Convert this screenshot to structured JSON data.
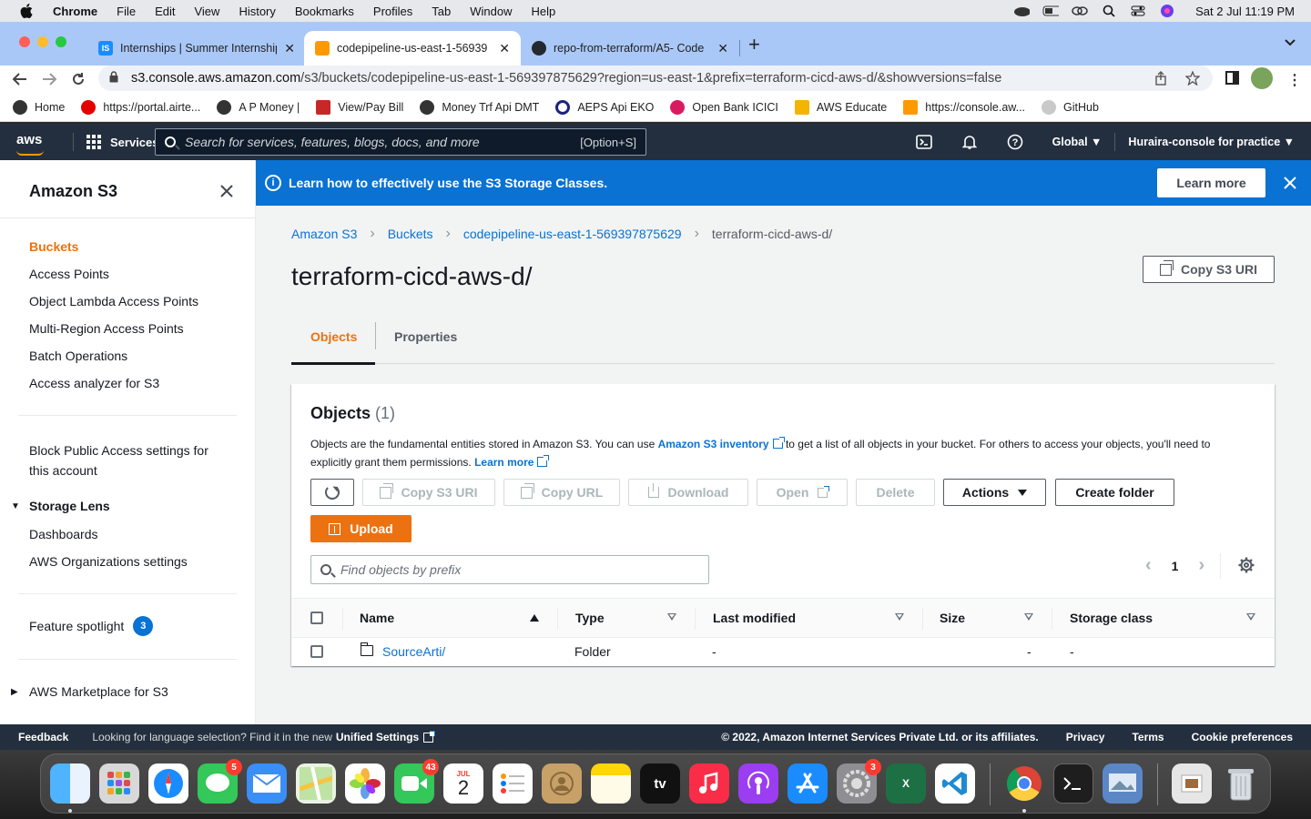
{
  "menubar": {
    "app": "Chrome",
    "items": [
      "File",
      "Edit",
      "View",
      "History",
      "Bookmarks",
      "Profiles",
      "Tab",
      "Window",
      "Help"
    ],
    "clock": "Sat 2 Jul  11:19 PM"
  },
  "tabs": [
    {
      "title": "Internships | Summer Internship",
      "favicon_text": "IS",
      "favicon_color": "#1a8cff",
      "active": false
    },
    {
      "title": "codepipeline-us-east-1-56939",
      "favicon_color": "#ff9900",
      "active": true
    },
    {
      "title": "repo-from-terraform/A5- Code",
      "favicon_color": "#24292f",
      "active": false
    }
  ],
  "address": {
    "host": "s3.console.aws.amazon.com",
    "path": "/s3/buckets/codepipeline-us-east-1-569397875629?region=us-east-1&prefix=terraform-cicd-aws-d/&showversions=false"
  },
  "bookmarks": [
    {
      "label": "Home",
      "color": "#333333"
    },
    {
      "label": "https://portal.airte...",
      "color": "#e40000"
    },
    {
      "label": "A P Money |",
      "color": "#333333"
    },
    {
      "label": "View/Pay Bill",
      "color": "#c62828"
    },
    {
      "label": "Money Trf Api DMT",
      "color": "#333333"
    },
    {
      "label": "AEPS Api EKO",
      "color": "#1a237e"
    },
    {
      "label": "Open Bank ICICI",
      "color": "#d81b60"
    },
    {
      "label": "AWS Educate",
      "color": "#f5b400"
    },
    {
      "label": "https://console.aw...",
      "color": "#ff9900"
    },
    {
      "label": "GitHub",
      "color": "#24292f"
    }
  ],
  "aws_header": {
    "logo": "aws",
    "services": "Services",
    "search_placeholder": "Search for services, features, blogs, docs, and more",
    "search_shortcut": "[Option+S]",
    "region": "Global",
    "account": "Huraira-console for practice"
  },
  "sidebar": {
    "title": "Amazon S3",
    "items": [
      {
        "label": "Buckets",
        "active": true
      },
      {
        "label": "Access Points"
      },
      {
        "label": "Object Lambda Access Points"
      },
      {
        "label": "Multi-Region Access Points"
      },
      {
        "label": "Batch Operations"
      },
      {
        "label": "Access analyzer for S3"
      }
    ],
    "block_public_access_line1": "Block Public Access settings for",
    "block_public_access_line2": "this account",
    "storage_lens": {
      "label": "Storage Lens",
      "items": [
        "Dashboards",
        "AWS Organizations settings"
      ]
    },
    "feature_spotlight": "Feature spotlight",
    "feature_spotlight_count": "3",
    "marketplace": "AWS Marketplace for S3"
  },
  "banner": {
    "text": "Learn how to effectively use the S3 Storage Classes.",
    "button": "Learn more"
  },
  "breadcrumb": [
    "Amazon S3",
    "Buckets",
    "codepipeline-us-east-1-569397875629",
    "terraform-cicd-aws-d/"
  ],
  "page": {
    "title": "terraform-cicd-aws-d/",
    "copy_uri": "Copy S3 URI",
    "tabs": [
      "Objects",
      "Properties"
    ],
    "active_tab": "Objects"
  },
  "objects_panel": {
    "title": "Objects",
    "count": "(1)",
    "desc_part1": "Objects are the fundamental entities stored in Amazon S3. You can use ",
    "desc_link1": "Amazon S3 inventory",
    "desc_part2": " to get a list of all objects in your bucket. For others to access your objects, you'll need to explicitly grant them permissions. ",
    "desc_link2": "Learn more",
    "buttons": {
      "copy_uri": "Copy S3 URI",
      "copy_url": "Copy URL",
      "download": "Download",
      "open": "Open",
      "delete": "Delete",
      "actions": "Actions",
      "create_folder": "Create folder",
      "upload": "Upload"
    },
    "filter_placeholder": "Find objects by prefix",
    "page_number": "1",
    "columns": [
      "Name",
      "Type",
      "Last modified",
      "Size",
      "Storage class"
    ],
    "rows": [
      {
        "name": "SourceArti/",
        "type": "Folder",
        "last_modified": "-",
        "size": "-",
        "storage_class": "-"
      }
    ]
  },
  "footer": {
    "feedback": "Feedback",
    "language": "Looking for language selection? Find it in the new",
    "unified": "Unified Settings",
    "copyright": "© 2022, Amazon Internet Services Private Ltd. or its affiliates.",
    "links": [
      "Privacy",
      "Terms",
      "Cookie preferences"
    ]
  },
  "dock": {
    "badges": {
      "messages": "5",
      "facetime": "43",
      "settings": "3"
    },
    "calendar_month": "JUL",
    "calendar_day": "2",
    "tv_label": "tv"
  },
  "colors": {
    "aws_orange": "#ec7211",
    "aws_blue": "#0972d3",
    "aws_navy": "#232f3e"
  }
}
